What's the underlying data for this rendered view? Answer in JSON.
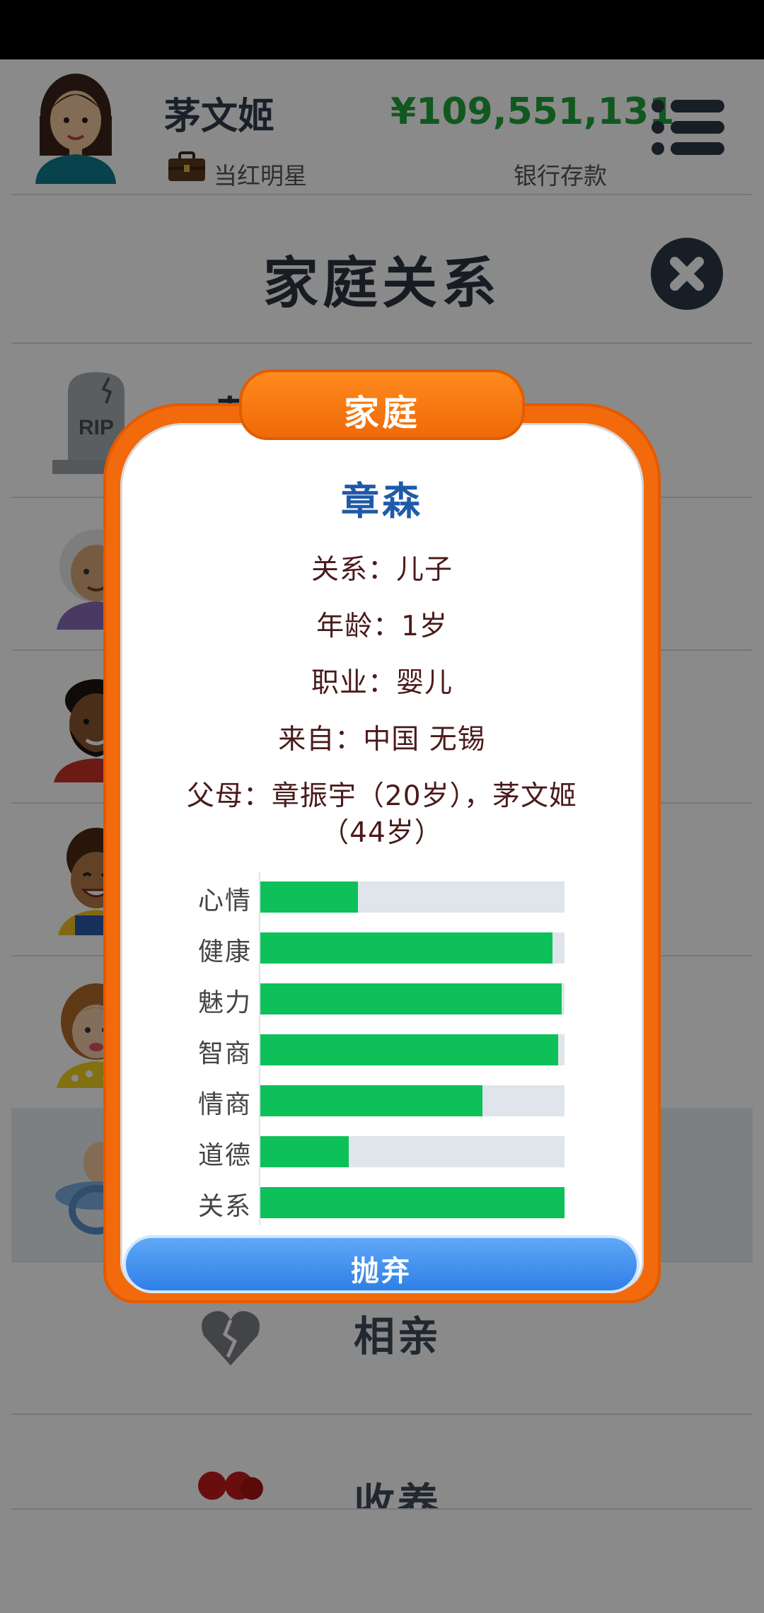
{
  "header": {
    "player_name": "茅文姬",
    "job": "当红明星",
    "money": "¥109,551,131",
    "money_label": "银行存款"
  },
  "page": {
    "title": "家庭关系"
  },
  "list": {
    "rows": [
      {
        "name": "茅",
        "icon": "tombstone-rip-icon"
      },
      {
        "name": "",
        "icon": "elderly-woman-avatar"
      },
      {
        "name": "",
        "icon": "bearded-man-avatar"
      },
      {
        "name": "",
        "icon": "curly-child-avatar"
      },
      {
        "name": "",
        "icon": "girl-avatar"
      },
      {
        "name": "",
        "icon": "pacifier-baby-icon"
      }
    ],
    "actions": [
      {
        "label": "相亲",
        "icon": "broken-heart-icon"
      },
      {
        "label": "收养",
        "icon": "hearts-icon"
      }
    ],
    "rip_text": "RIP"
  },
  "modal": {
    "tab_title": "家庭",
    "person_name": "章森",
    "relation": "关系：儿子",
    "age": "年龄：1岁",
    "occupation": "职业：婴儿",
    "origin": "来自：中国 无锡",
    "parents_line1": "父母：章振宇（20岁），茅文姬",
    "parents_line2": "（44岁）",
    "stats": [
      {
        "label": "心情",
        "value": 0.32
      },
      {
        "label": "健康",
        "value": 0.96
      },
      {
        "label": "魅力",
        "value": 0.99
      },
      {
        "label": "智商",
        "value": 0.98
      },
      {
        "label": "情商",
        "value": 0.73
      },
      {
        "label": "道德",
        "value": 0.29
      },
      {
        "label": "关系",
        "value": 1.0
      }
    ],
    "abandon_button": "抛弃"
  },
  "colors": {
    "money_green": "#21a33a",
    "modal_orange": "#f26a0c",
    "name_blue": "#1f5aa8",
    "bar_green": "#0ec05a",
    "bar_track": "#dfe5ea",
    "button_blue": "#2f7fe6"
  }
}
